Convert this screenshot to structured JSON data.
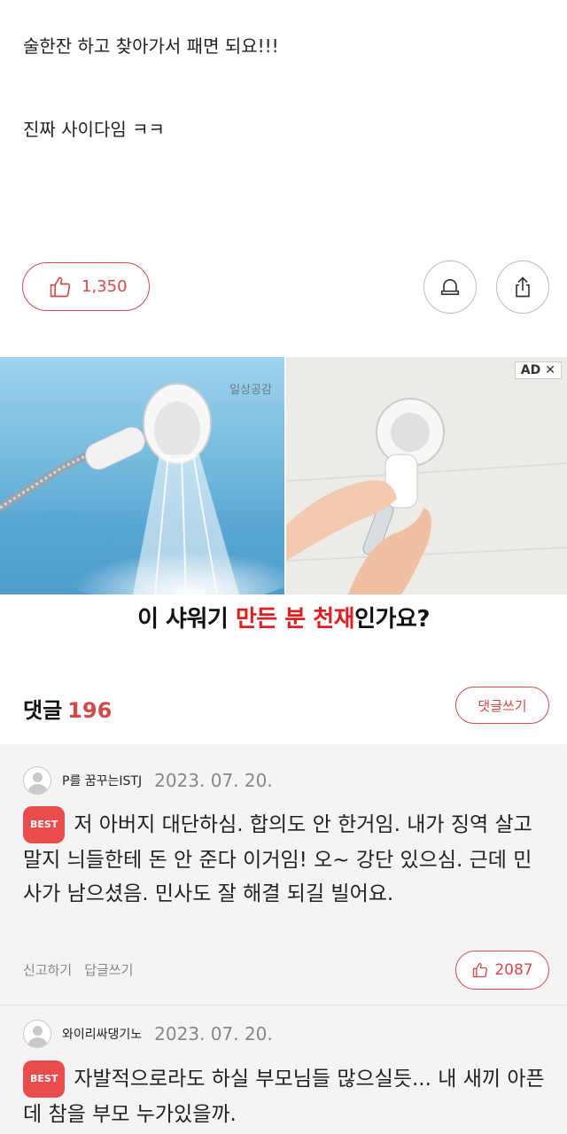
{
  "post": {
    "line1": "술한잔 하고 찾아가서 패면 되요!!!",
    "line2": "진짜 사이다임 ㅋㅋ"
  },
  "actions": {
    "like_count": "1,350",
    "icons": {
      "like": "thumbs-up-icon",
      "bell": "bell-icon",
      "share": "share-icon"
    },
    "accent_color": "#d44a4a"
  },
  "ad": {
    "watermark": "일상공감",
    "badge": "AD",
    "close_glyph": "✕",
    "caption_a": "이 샤워기 ",
    "caption_red": "만든 분 천재",
    "caption_b": "인가요?"
  },
  "comments": {
    "title": "댓글",
    "count": "196",
    "write_label": "댓글쓰기",
    "items": [
      {
        "user": "P를 꿈꾸는ISTJ",
        "date": "2023. 07. 20.",
        "badge": "BEST",
        "body": "저 아버지 대단하심. 합의도 안 한거임. 내가 징역 살고 말지 늬들한테 돈 안 준다 이거임! 오~ 강단 있으심. 근데 민사가 남으셨음. 민사도 잘 해결 되길 빌어요.",
        "report": "신고하기",
        "reply": "답글쓰기",
        "likes": "2087"
      },
      {
        "user": "와이리싸댕기노",
        "date": "2023. 07. 20.",
        "badge": "BEST",
        "body": "자발적으로라도 하실 부모님들 많으실듯... 내 새끼 아픈데 참을 부모 누가있을까."
      }
    ]
  }
}
